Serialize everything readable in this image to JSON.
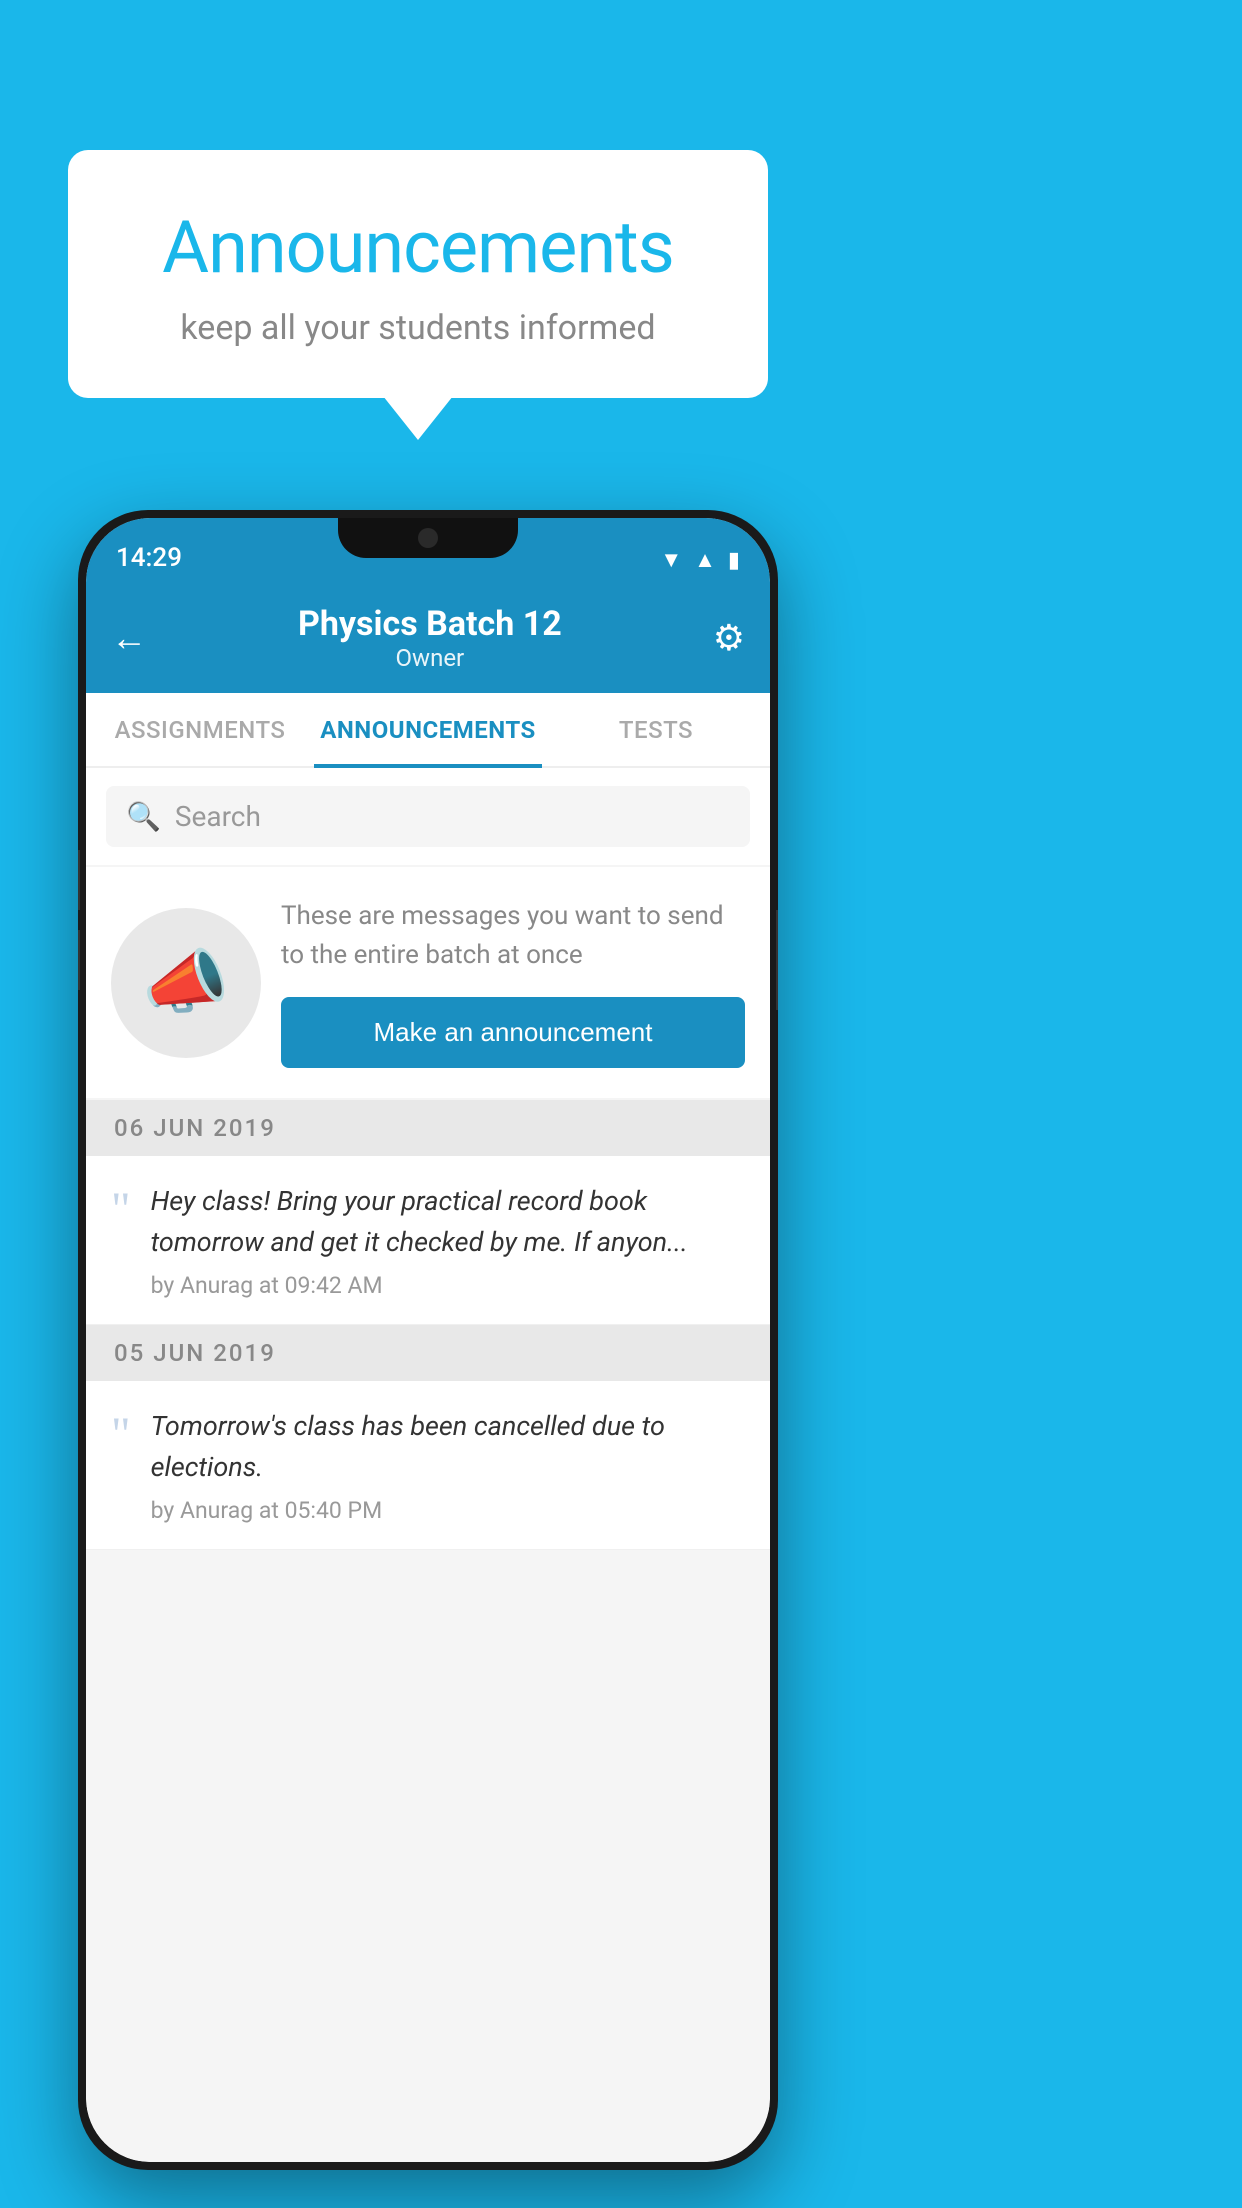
{
  "background_color": "#1ab7ea",
  "speech_bubble": {
    "title": "Announcements",
    "subtitle": "keep all your students informed"
  },
  "phone": {
    "status_bar": {
      "time": "14:29",
      "icons": [
        "wifi",
        "signal",
        "battery"
      ]
    },
    "header": {
      "title": "Physics Batch 12",
      "subtitle": "Owner",
      "back_label": "←",
      "gear_label": "⚙"
    },
    "tabs": [
      {
        "label": "ASSIGNMENTS",
        "active": false
      },
      {
        "label": "ANNOUNCEMENTS",
        "active": true
      },
      {
        "label": "TESTS",
        "active": false
      }
    ],
    "search": {
      "placeholder": "Search"
    },
    "promo": {
      "text": "These are messages you want to send to the entire batch at once",
      "button_label": "Make an announcement"
    },
    "announcements": [
      {
        "date": "06  JUN  2019",
        "items": [
          {
            "message": "Hey class! Bring your practical record book tomorrow and get it checked by me. If anyon...",
            "author": "by Anurag at 09:42 AM"
          }
        ]
      },
      {
        "date": "05  JUN  2019",
        "items": [
          {
            "message": "Tomorrow's class has been cancelled due to elections.",
            "author": "by Anurag at 05:40 PM"
          }
        ]
      }
    ]
  }
}
